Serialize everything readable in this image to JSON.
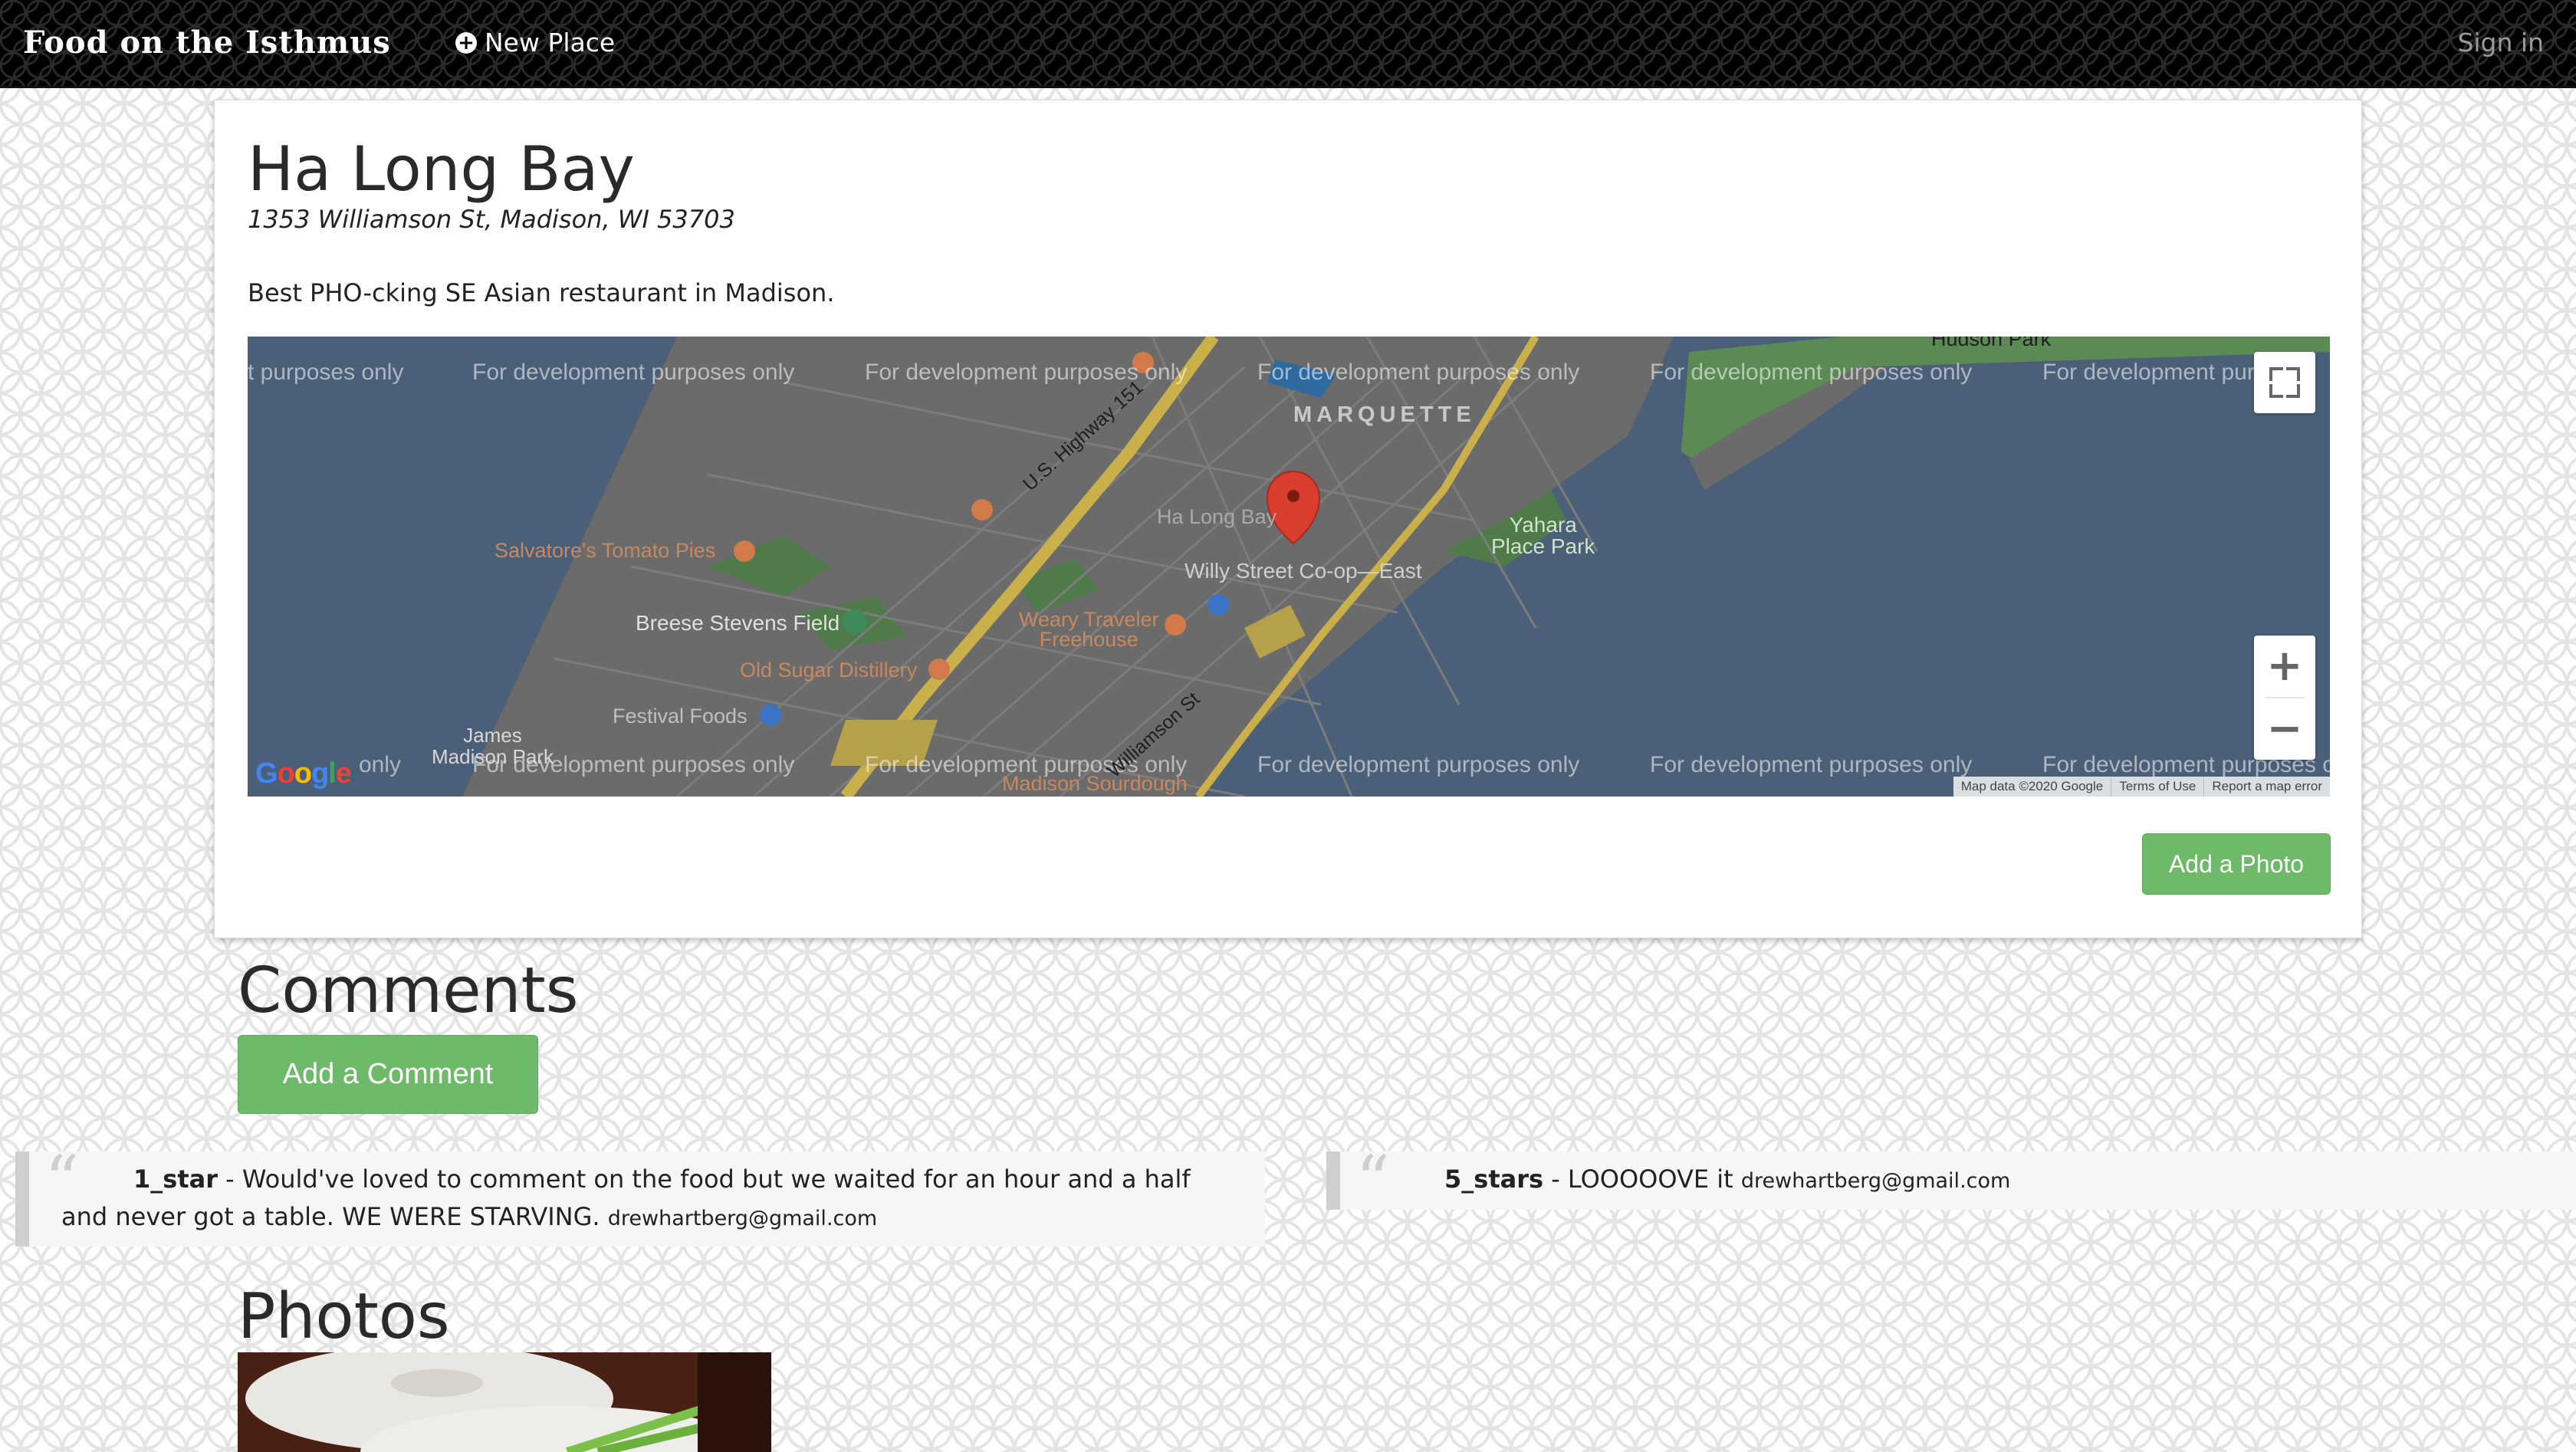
{
  "navbar": {
    "brand": "Food on the Isthmus",
    "new_place": "New Place",
    "sign_in": "Sign in"
  },
  "place": {
    "name": "Ha Long Bay",
    "address": "1353 Williamson St, Madison, WI 53703",
    "description": "Best PHO-cking SE Asian restaurant in Madison."
  },
  "map": {
    "watermark": "For development purposes only",
    "watermark_partial_left": "t purposes only",
    "watermark_partial_right": "For development pur",
    "watermark_partial_right_bottom": "For development purposes c",
    "bottom_left_partial": "t",
    "bottom_left_tail": "only",
    "neighborhood": "MARQUETTE",
    "places": {
      "ha_long_bay": "Ha Long Bay",
      "willy_street": "Willy Street Co-op—East",
      "salvatores": "Salvatore's Tomato Pies",
      "breese": "Breese Stevens Field",
      "weary": "Weary Traveler\nFreehouse",
      "old_sugar": "Old Sugar Distillery",
      "festival": "Festival Foods",
      "yahara": "Yahara\nPlace Park",
      "james_madison": "James\nMadison Park",
      "madison_sourdough": "Madison Sourdough",
      "highway": "U.S. Highway 151",
      "williamson": "Williamson St",
      "hudson_park": "Hudson Park"
    },
    "attribution": {
      "map_data": "Map data ©2020 Google",
      "terms": "Terms of Use",
      "report": "Report a map error"
    },
    "zoom_in": "+",
    "zoom_out": "−",
    "google": "Google"
  },
  "add_photo": "Add a Photo",
  "comments": {
    "title": "Comments",
    "add_button": "Add a Comment",
    "items": [
      {
        "rating": "1_star",
        "text": " - Would've loved to comment on the food but we waited for an hour and a half and never got a table. WE WERE STARVING.",
        "email": "drewhartberg@gmail.com"
      },
      {
        "rating": "5_stars",
        "text": " - LOOOOOVE it",
        "email": "drewhartberg@gmail.com"
      }
    ]
  },
  "photos": {
    "title": "Photos"
  },
  "colors": {
    "button_green": "#6fb96a",
    "map_water": "#4b5f78",
    "map_land": "#6b6b6b",
    "map_road_yellow": "#c9b04a",
    "marker_red": "#d93d2d"
  }
}
